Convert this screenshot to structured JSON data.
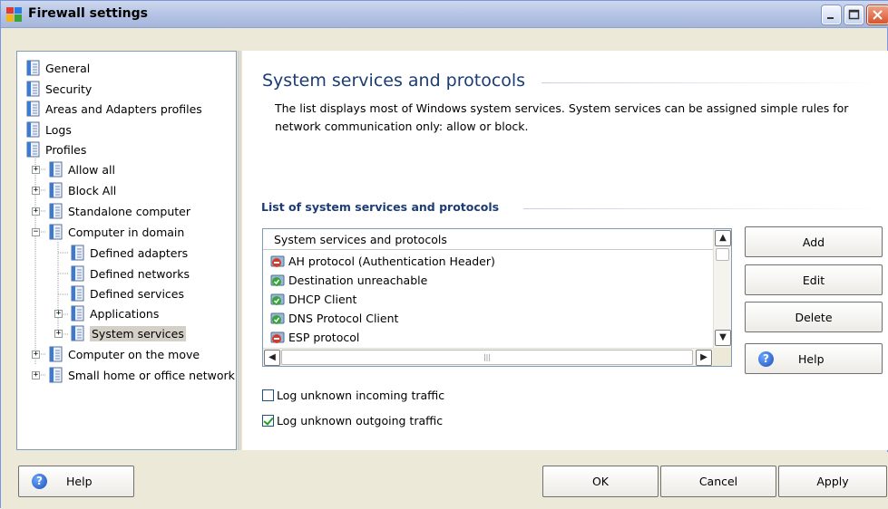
{
  "window": {
    "title": "Firewall settings"
  },
  "tree": {
    "items": [
      {
        "label": "General",
        "level": 0
      },
      {
        "label": "Security",
        "level": 0
      },
      {
        "label": "Areas and Adapters profiles",
        "level": 0
      },
      {
        "label": "Logs",
        "level": 0
      },
      {
        "label": "Profiles",
        "level": 0
      },
      {
        "label": "Allow all",
        "level": 1
      },
      {
        "label": "Block All",
        "level": 1
      },
      {
        "label": "Standalone computer",
        "level": 1
      },
      {
        "label": "Computer in domain",
        "level": 1
      },
      {
        "label": "Defined adapters",
        "level": 2
      },
      {
        "label": "Defined networks",
        "level": 2
      },
      {
        "label": "Defined services",
        "level": 2
      },
      {
        "label": "Applications",
        "level": 2
      },
      {
        "label": "System services",
        "level": 2,
        "selected": true
      },
      {
        "label": "Computer on the move",
        "level": 1
      },
      {
        "label": "Small home or office network",
        "level": 1
      }
    ]
  },
  "content": {
    "title": "System services and protocols",
    "description": "The list displays most of Windows system services. System services can be assigned simple rules for network communication only: allow or block.",
    "section_title": "List of system services and protocols",
    "list": {
      "header": "System services and protocols",
      "rows": [
        {
          "label": "AH protocol (Authentication Header)",
          "status": "block"
        },
        {
          "label": "Destination unreachable",
          "status": "allow"
        },
        {
          "label": "DHCP Client",
          "status": "allow"
        },
        {
          "label": "DNS Protocol Client",
          "status": "allow"
        },
        {
          "label": "ESP protocol",
          "status": "block"
        }
      ]
    },
    "buttons": {
      "add": "Add",
      "edit": "Edit",
      "delete": "Delete",
      "help": "Help"
    },
    "checkboxes": {
      "incoming_label": "Log unknown incoming traffic",
      "incoming_checked": false,
      "outgoing_label": "Log unknown outgoing traffic",
      "outgoing_checked": true
    }
  },
  "footer": {
    "help": "Help",
    "ok": "OK",
    "cancel": "Cancel",
    "apply": "Apply"
  },
  "colors": {
    "heading": "#1c3c74",
    "allow_icon": "#3aa43a",
    "block_icon": "#d83a2a"
  }
}
